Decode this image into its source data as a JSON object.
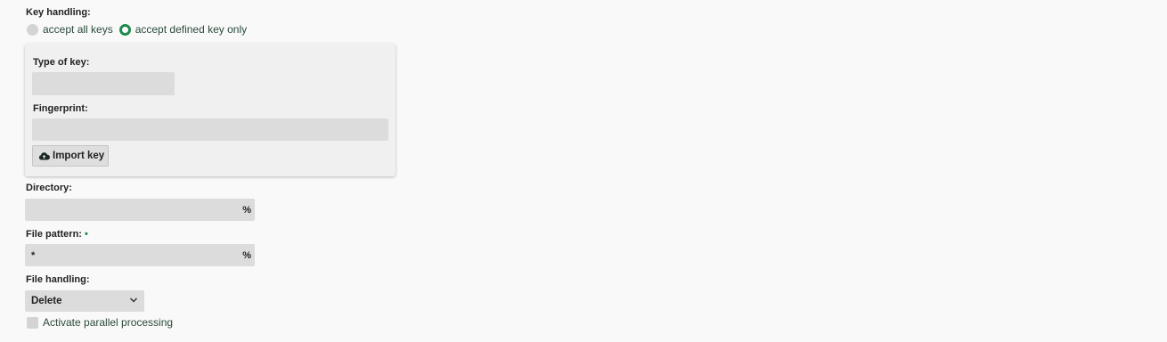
{
  "key_handling": {
    "label": "Key handling:",
    "options": [
      {
        "label": "accept all keys",
        "selected": false
      },
      {
        "label": "accept defined key only",
        "selected": true
      }
    ]
  },
  "key_panel": {
    "type_label": "Type of key:",
    "type_value": "",
    "fingerprint_label": "Fingerprint:",
    "fingerprint_value": "",
    "import_button": "Import key"
  },
  "directory": {
    "label": "Directory:",
    "value": "",
    "percent_icon": "%"
  },
  "file_pattern": {
    "label": "File pattern:",
    "required_marker": "•",
    "value": "*",
    "percent_icon": "%"
  },
  "file_handling": {
    "label": "File handling:",
    "selected": "Delete"
  },
  "parallel": {
    "label": "Activate parallel processing",
    "checked": false
  },
  "colors": {
    "accent": "#1f8a4e",
    "field_bg": "#dcdcdc",
    "panel_bg": "#f0f0f0"
  }
}
